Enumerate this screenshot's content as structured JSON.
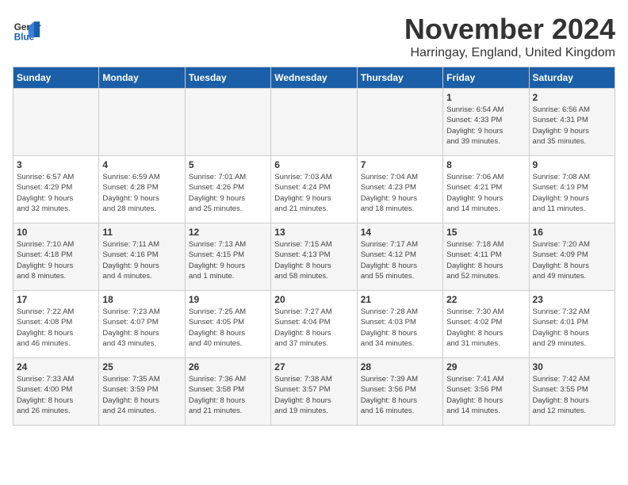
{
  "header": {
    "logo_line1": "General",
    "logo_line2": "Blue",
    "month_title": "November 2024",
    "location": "Harringay, England, United Kingdom"
  },
  "days_of_week": [
    "Sunday",
    "Monday",
    "Tuesday",
    "Wednesday",
    "Thursday",
    "Friday",
    "Saturday"
  ],
  "weeks": [
    [
      {
        "day": "",
        "info": ""
      },
      {
        "day": "",
        "info": ""
      },
      {
        "day": "",
        "info": ""
      },
      {
        "day": "",
        "info": ""
      },
      {
        "day": "",
        "info": ""
      },
      {
        "day": "1",
        "info": "Sunrise: 6:54 AM\nSunset: 4:33 PM\nDaylight: 9 hours\nand 39 minutes."
      },
      {
        "day": "2",
        "info": "Sunrise: 6:56 AM\nSunset: 4:31 PM\nDaylight: 9 hours\nand 35 minutes."
      }
    ],
    [
      {
        "day": "3",
        "info": "Sunrise: 6:57 AM\nSunset: 4:29 PM\nDaylight: 9 hours\nand 32 minutes."
      },
      {
        "day": "4",
        "info": "Sunrise: 6:59 AM\nSunset: 4:28 PM\nDaylight: 9 hours\nand 28 minutes."
      },
      {
        "day": "5",
        "info": "Sunrise: 7:01 AM\nSunset: 4:26 PM\nDaylight: 9 hours\nand 25 minutes."
      },
      {
        "day": "6",
        "info": "Sunrise: 7:03 AM\nSunset: 4:24 PM\nDaylight: 9 hours\nand 21 minutes."
      },
      {
        "day": "7",
        "info": "Sunrise: 7:04 AM\nSunset: 4:23 PM\nDaylight: 9 hours\nand 18 minutes."
      },
      {
        "day": "8",
        "info": "Sunrise: 7:06 AM\nSunset: 4:21 PM\nDaylight: 9 hours\nand 14 minutes."
      },
      {
        "day": "9",
        "info": "Sunrise: 7:08 AM\nSunset: 4:19 PM\nDaylight: 9 hours\nand 11 minutes."
      }
    ],
    [
      {
        "day": "10",
        "info": "Sunrise: 7:10 AM\nSunset: 4:18 PM\nDaylight: 9 hours\nand 8 minutes."
      },
      {
        "day": "11",
        "info": "Sunrise: 7:11 AM\nSunset: 4:16 PM\nDaylight: 9 hours\nand 4 minutes."
      },
      {
        "day": "12",
        "info": "Sunrise: 7:13 AM\nSunset: 4:15 PM\nDaylight: 9 hours\nand 1 minute."
      },
      {
        "day": "13",
        "info": "Sunrise: 7:15 AM\nSunset: 4:13 PM\nDaylight: 8 hours\nand 58 minutes."
      },
      {
        "day": "14",
        "info": "Sunrise: 7:17 AM\nSunset: 4:12 PM\nDaylight: 8 hours\nand 55 minutes."
      },
      {
        "day": "15",
        "info": "Sunrise: 7:18 AM\nSunset: 4:11 PM\nDaylight: 8 hours\nand 52 minutes."
      },
      {
        "day": "16",
        "info": "Sunrise: 7:20 AM\nSunset: 4:09 PM\nDaylight: 8 hours\nand 49 minutes."
      }
    ],
    [
      {
        "day": "17",
        "info": "Sunrise: 7:22 AM\nSunset: 4:08 PM\nDaylight: 8 hours\nand 46 minutes."
      },
      {
        "day": "18",
        "info": "Sunrise: 7:23 AM\nSunset: 4:07 PM\nDaylight: 8 hours\nand 43 minutes."
      },
      {
        "day": "19",
        "info": "Sunrise: 7:25 AM\nSunset: 4:05 PM\nDaylight: 8 hours\nand 40 minutes."
      },
      {
        "day": "20",
        "info": "Sunrise: 7:27 AM\nSunset: 4:04 PM\nDaylight: 8 hours\nand 37 minutes."
      },
      {
        "day": "21",
        "info": "Sunrise: 7:28 AM\nSunset: 4:03 PM\nDaylight: 8 hours\nand 34 minutes."
      },
      {
        "day": "22",
        "info": "Sunrise: 7:30 AM\nSunset: 4:02 PM\nDaylight: 8 hours\nand 31 minutes."
      },
      {
        "day": "23",
        "info": "Sunrise: 7:32 AM\nSunset: 4:01 PM\nDaylight: 8 hours\nand 29 minutes."
      }
    ],
    [
      {
        "day": "24",
        "info": "Sunrise: 7:33 AM\nSunset: 4:00 PM\nDaylight: 8 hours\nand 26 minutes."
      },
      {
        "day": "25",
        "info": "Sunrise: 7:35 AM\nSunset: 3:59 PM\nDaylight: 8 hours\nand 24 minutes."
      },
      {
        "day": "26",
        "info": "Sunrise: 7:36 AM\nSunset: 3:58 PM\nDaylight: 8 hours\nand 21 minutes."
      },
      {
        "day": "27",
        "info": "Sunrise: 7:38 AM\nSunset: 3:57 PM\nDaylight: 8 hours\nand 19 minutes."
      },
      {
        "day": "28",
        "info": "Sunrise: 7:39 AM\nSunset: 3:56 PM\nDaylight: 8 hours\nand 16 minutes."
      },
      {
        "day": "29",
        "info": "Sunrise: 7:41 AM\nSunset: 3:56 PM\nDaylight: 8 hours\nand 14 minutes."
      },
      {
        "day": "30",
        "info": "Sunrise: 7:42 AM\nSunset: 3:55 PM\nDaylight: 8 hours\nand 12 minutes."
      }
    ]
  ]
}
